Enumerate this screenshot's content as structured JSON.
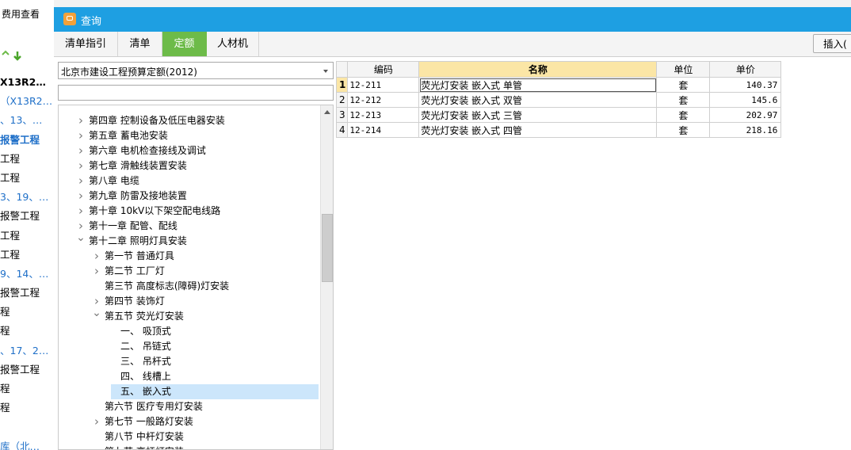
{
  "background": {
    "fee_view_label": "费用查看",
    "left_items": [
      {
        "text": "X13R2…",
        "style": "bold"
      },
      {
        "text": "（X13R2…",
        "style": "blue"
      },
      {
        "text": "、13、…",
        "style": "blue"
      },
      {
        "text": "报警工程",
        "style": "blue-bold"
      },
      {
        "text": "工程",
        "style": ""
      },
      {
        "text": "工程",
        "style": ""
      },
      {
        "text": "3、19、…",
        "style": "blue"
      },
      {
        "text": "报警工程",
        "style": ""
      },
      {
        "text": "工程",
        "style": ""
      },
      {
        "text": "工程",
        "style": ""
      },
      {
        "text": "9、14、…",
        "style": "blue"
      },
      {
        "text": "报警工程",
        "style": ""
      },
      {
        "text": "程",
        "style": ""
      },
      {
        "text": "程",
        "style": ""
      },
      {
        "text": "、17、2…",
        "style": "blue"
      },
      {
        "text": "报警工程",
        "style": ""
      },
      {
        "text": "程",
        "style": ""
      },
      {
        "text": "程",
        "style": ""
      },
      {
        "text": "",
        "style": ""
      },
      {
        "text": "库（北…",
        "style": "blue"
      }
    ]
  },
  "dialog": {
    "title": "查询",
    "tabs": [
      {
        "label": "清单指引",
        "active": false
      },
      {
        "label": "清单",
        "active": false
      },
      {
        "label": "定额",
        "active": true
      },
      {
        "label": "人材机",
        "active": false
      }
    ],
    "insert_label": "插入(",
    "quota_library": "北京市建设工程预算定额(2012)",
    "search": {
      "value": "",
      "placeholder": ""
    }
  },
  "tree": [
    {
      "text": "第四章  控制设备及低压电器安装",
      "level": 0,
      "arrow": "right",
      "selected": false
    },
    {
      "text": "第五章  蓄电池安装",
      "level": 0,
      "arrow": "right",
      "selected": false
    },
    {
      "text": "第六章  电机检查接线及调试",
      "level": 0,
      "arrow": "right",
      "selected": false
    },
    {
      "text": "第七章  滑触线装置安装",
      "level": 0,
      "arrow": "right",
      "selected": false
    },
    {
      "text": "第八章  电缆",
      "level": 0,
      "arrow": "right",
      "selected": false
    },
    {
      "text": "第九章  防雷及接地装置",
      "level": 0,
      "arrow": "right",
      "selected": false
    },
    {
      "text": "第十章  10kV以下架空配电线路",
      "level": 0,
      "arrow": "right",
      "selected": false
    },
    {
      "text": "第十一章  配管、配线",
      "level": 0,
      "arrow": "right",
      "selected": false
    },
    {
      "text": "第十二章  照明灯具安装",
      "level": 0,
      "arrow": "down",
      "selected": false
    },
    {
      "text": "第一节  普通灯具",
      "level": 1,
      "arrow": "right",
      "selected": false
    },
    {
      "text": "第二节  工厂灯",
      "level": 1,
      "arrow": "right",
      "selected": false
    },
    {
      "text": "第三节  高度标志(障碍)灯安装",
      "level": 1,
      "arrow": "",
      "selected": false
    },
    {
      "text": "第四节  装饰灯",
      "level": 1,
      "arrow": "right",
      "selected": false
    },
    {
      "text": "第五节  荧光灯安装",
      "level": 1,
      "arrow": "down",
      "selected": false
    },
    {
      "text": "一、  吸顶式",
      "level": 2,
      "arrow": "",
      "selected": false
    },
    {
      "text": "二、  吊链式",
      "level": 2,
      "arrow": "",
      "selected": false
    },
    {
      "text": "三、  吊杆式",
      "level": 2,
      "arrow": "",
      "selected": false
    },
    {
      "text": "四、  线槽上",
      "level": 2,
      "arrow": "",
      "selected": false
    },
    {
      "text": "五、  嵌入式",
      "level": 2,
      "arrow": "",
      "selected": true
    },
    {
      "text": "第六节  医疗专用灯安装",
      "level": 1,
      "arrow": "",
      "selected": false
    },
    {
      "text": "第七节  一般路灯安装",
      "level": 1,
      "arrow": "right",
      "selected": false
    },
    {
      "text": "第八节  中杆灯安装",
      "level": 1,
      "arrow": "",
      "selected": false
    },
    {
      "text": "第九节  高杆灯安装",
      "level": 1,
      "arrow": "right",
      "selected": false
    }
  ],
  "grid": {
    "columns": [
      "编码",
      "名称",
      "单位",
      "单价"
    ],
    "rows": [
      {
        "num": "1",
        "code": "12-211",
        "name": "荧光灯安装  嵌入式  单管",
        "unit": "套",
        "price": "140.37"
      },
      {
        "num": "2",
        "code": "12-212",
        "name": "荧光灯安装  嵌入式  双管",
        "unit": "套",
        "price": "145.6"
      },
      {
        "num": "3",
        "code": "12-213",
        "name": "荧光灯安装  嵌入式  三管",
        "unit": "套",
        "price": "202.97"
      },
      {
        "num": "4",
        "code": "12-214",
        "name": "荧光灯安装  嵌入式  四管",
        "unit": "套",
        "price": "218.16"
      }
    ]
  },
  "colors": {
    "title_bar": "#1e9fe2",
    "active_tab": "#6dbb49",
    "selection": "#cce6fb",
    "header_highlight": "#fbe6a6",
    "link_blue": "#1e6fc8"
  }
}
